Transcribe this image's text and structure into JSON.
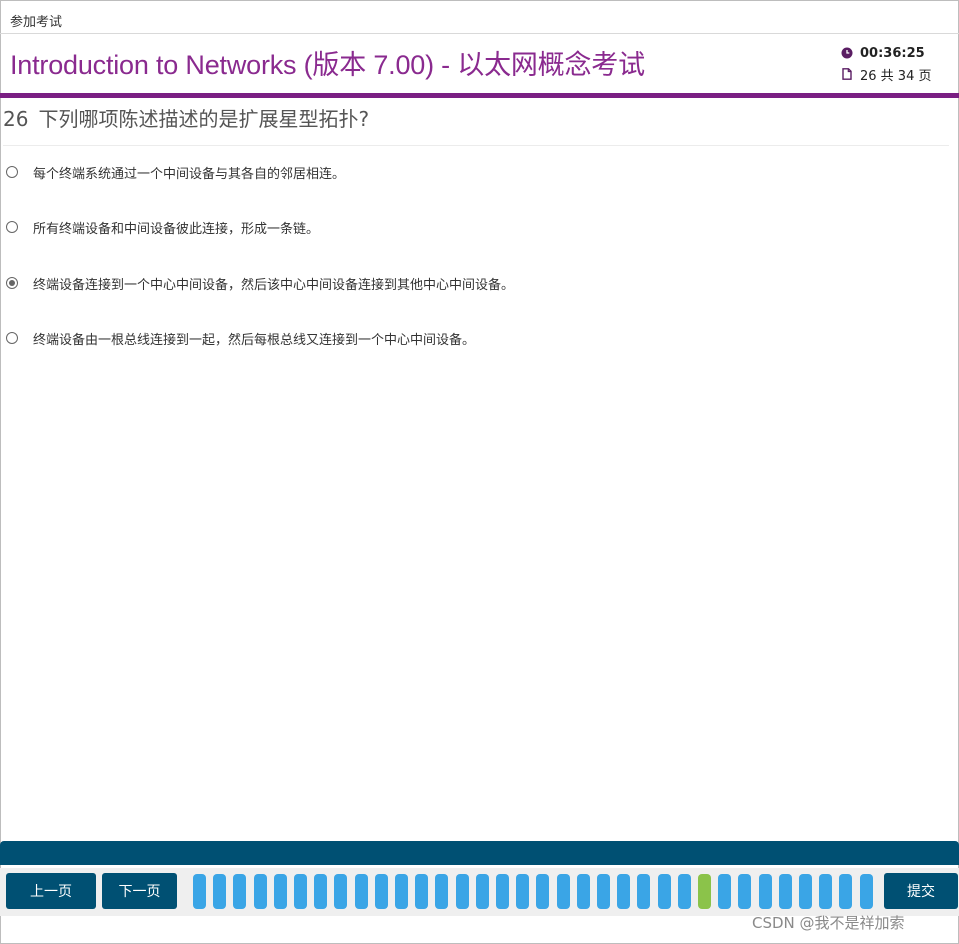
{
  "topbar": {
    "title": "参加考试"
  },
  "header": {
    "course": "Introduction to Networks (版本 7.00) - ",
    "exam": "以太网概念考试",
    "timer": "00:36:25",
    "page_info": "26 共 34 页",
    "accent_color": "#7a1f83",
    "title_color": "#8a2a8f"
  },
  "question": {
    "number": "26",
    "text": "下列哪项陈述描述的是扩展星型拓扑?"
  },
  "options": [
    {
      "label": "每个终端系统通过一个中间设备与其各自的邻居相连。",
      "selected": false
    },
    {
      "label": "所有终端设备和中间设备彼此连接，形成一条链。",
      "selected": false
    },
    {
      "label": "终端设备连接到一个中心中间设备，然后该中心中间设备连接到其他中心中间设备。",
      "selected": true
    },
    {
      "label": "终端设备由一根总线连接到一起，然后每根总线又连接到一个中心中间设备。",
      "selected": false
    }
  ],
  "nav": {
    "prev_label": "上一页",
    "next_label": "下一页",
    "submit_label": "提交",
    "total_pages": 34,
    "current_page": 26,
    "button_color": "#005073",
    "page_color": "#3aa5e6",
    "current_page_color": "#8bc34a"
  },
  "watermark": "CSDN @我不是祥加索"
}
